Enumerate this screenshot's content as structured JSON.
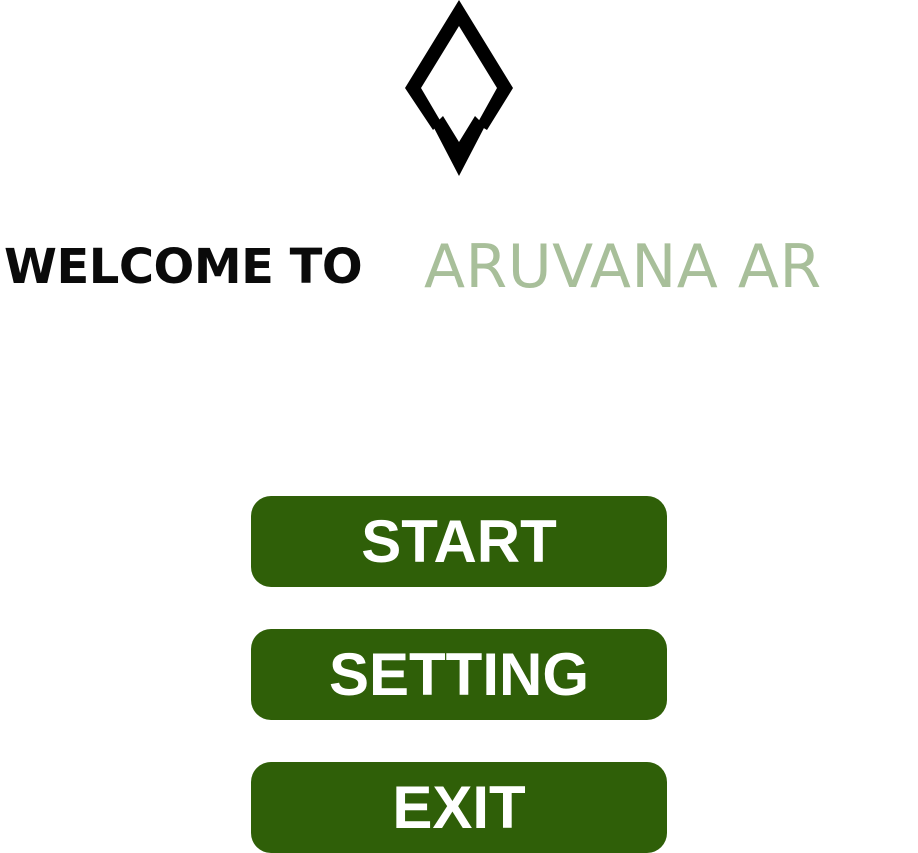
{
  "logo": {
    "icon": "aruvana-diamond-logo-icon",
    "color": "#000000"
  },
  "welcome": {
    "prefix": "WELCOME TO",
    "brand": "ARUVANA AR",
    "prefix_color": "#0a0a0a",
    "brand_color": "#a8bf9a"
  },
  "menu": {
    "button_color": "#2f5f08",
    "text_color": "#ffffff",
    "start_label": "START",
    "setting_label": "SETTING",
    "exit_label": "EXIT"
  }
}
